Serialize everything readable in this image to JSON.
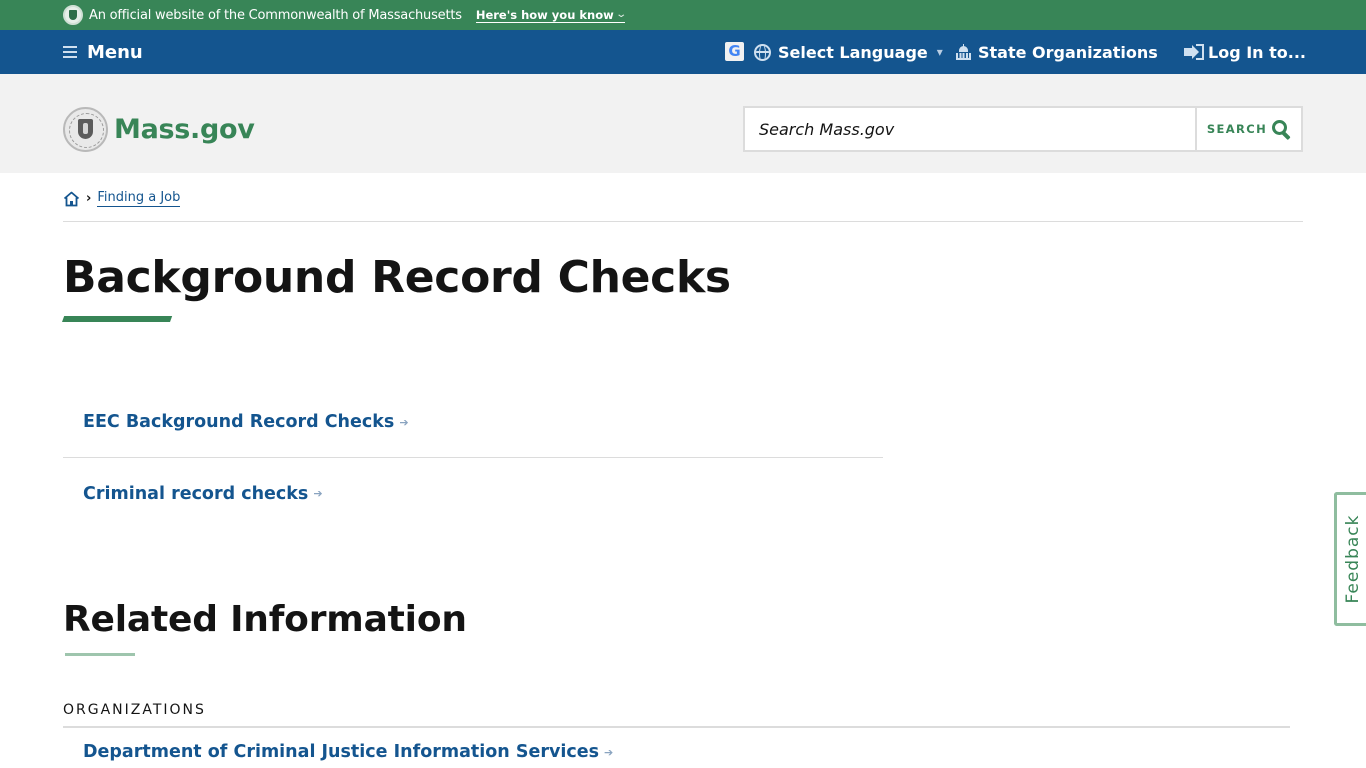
{
  "official_banner": {
    "text": "An official website of the Commonwealth of Massachusetts",
    "how_you_know": "Here's how you know",
    "chevron": "⌄"
  },
  "top_nav": {
    "menu_label": "Menu",
    "google_icon_letter": "G",
    "language_label": "Select Language",
    "language_chevron": "▾",
    "state_orgs_label": "State Organizations",
    "login_label": "Log In to..."
  },
  "header": {
    "logo_text": "Mass.gov",
    "search": {
      "placeholder": "Search Mass.gov",
      "value": "",
      "button_label": "SEARCH"
    }
  },
  "breadcrumb": {
    "separator": "›",
    "items": [
      {
        "label": "Finding a Job"
      }
    ]
  },
  "page": {
    "title": "Background Record Checks",
    "links": [
      {
        "label": "EEC Background Record Checks",
        "arrow": "➔"
      },
      {
        "label": "Criminal record checks",
        "arrow": "➔"
      }
    ]
  },
  "related": {
    "title": "Related Information",
    "section_label": "ORGANIZATIONS",
    "items": [
      {
        "label": "Department of Criminal Justice Information Services",
        "arrow": "➔"
      }
    ]
  },
  "feedback": {
    "label": "Feedback"
  },
  "colors": {
    "brand_green": "#388557",
    "nav_blue": "#14558f",
    "header_gray": "#f2f2f2"
  }
}
